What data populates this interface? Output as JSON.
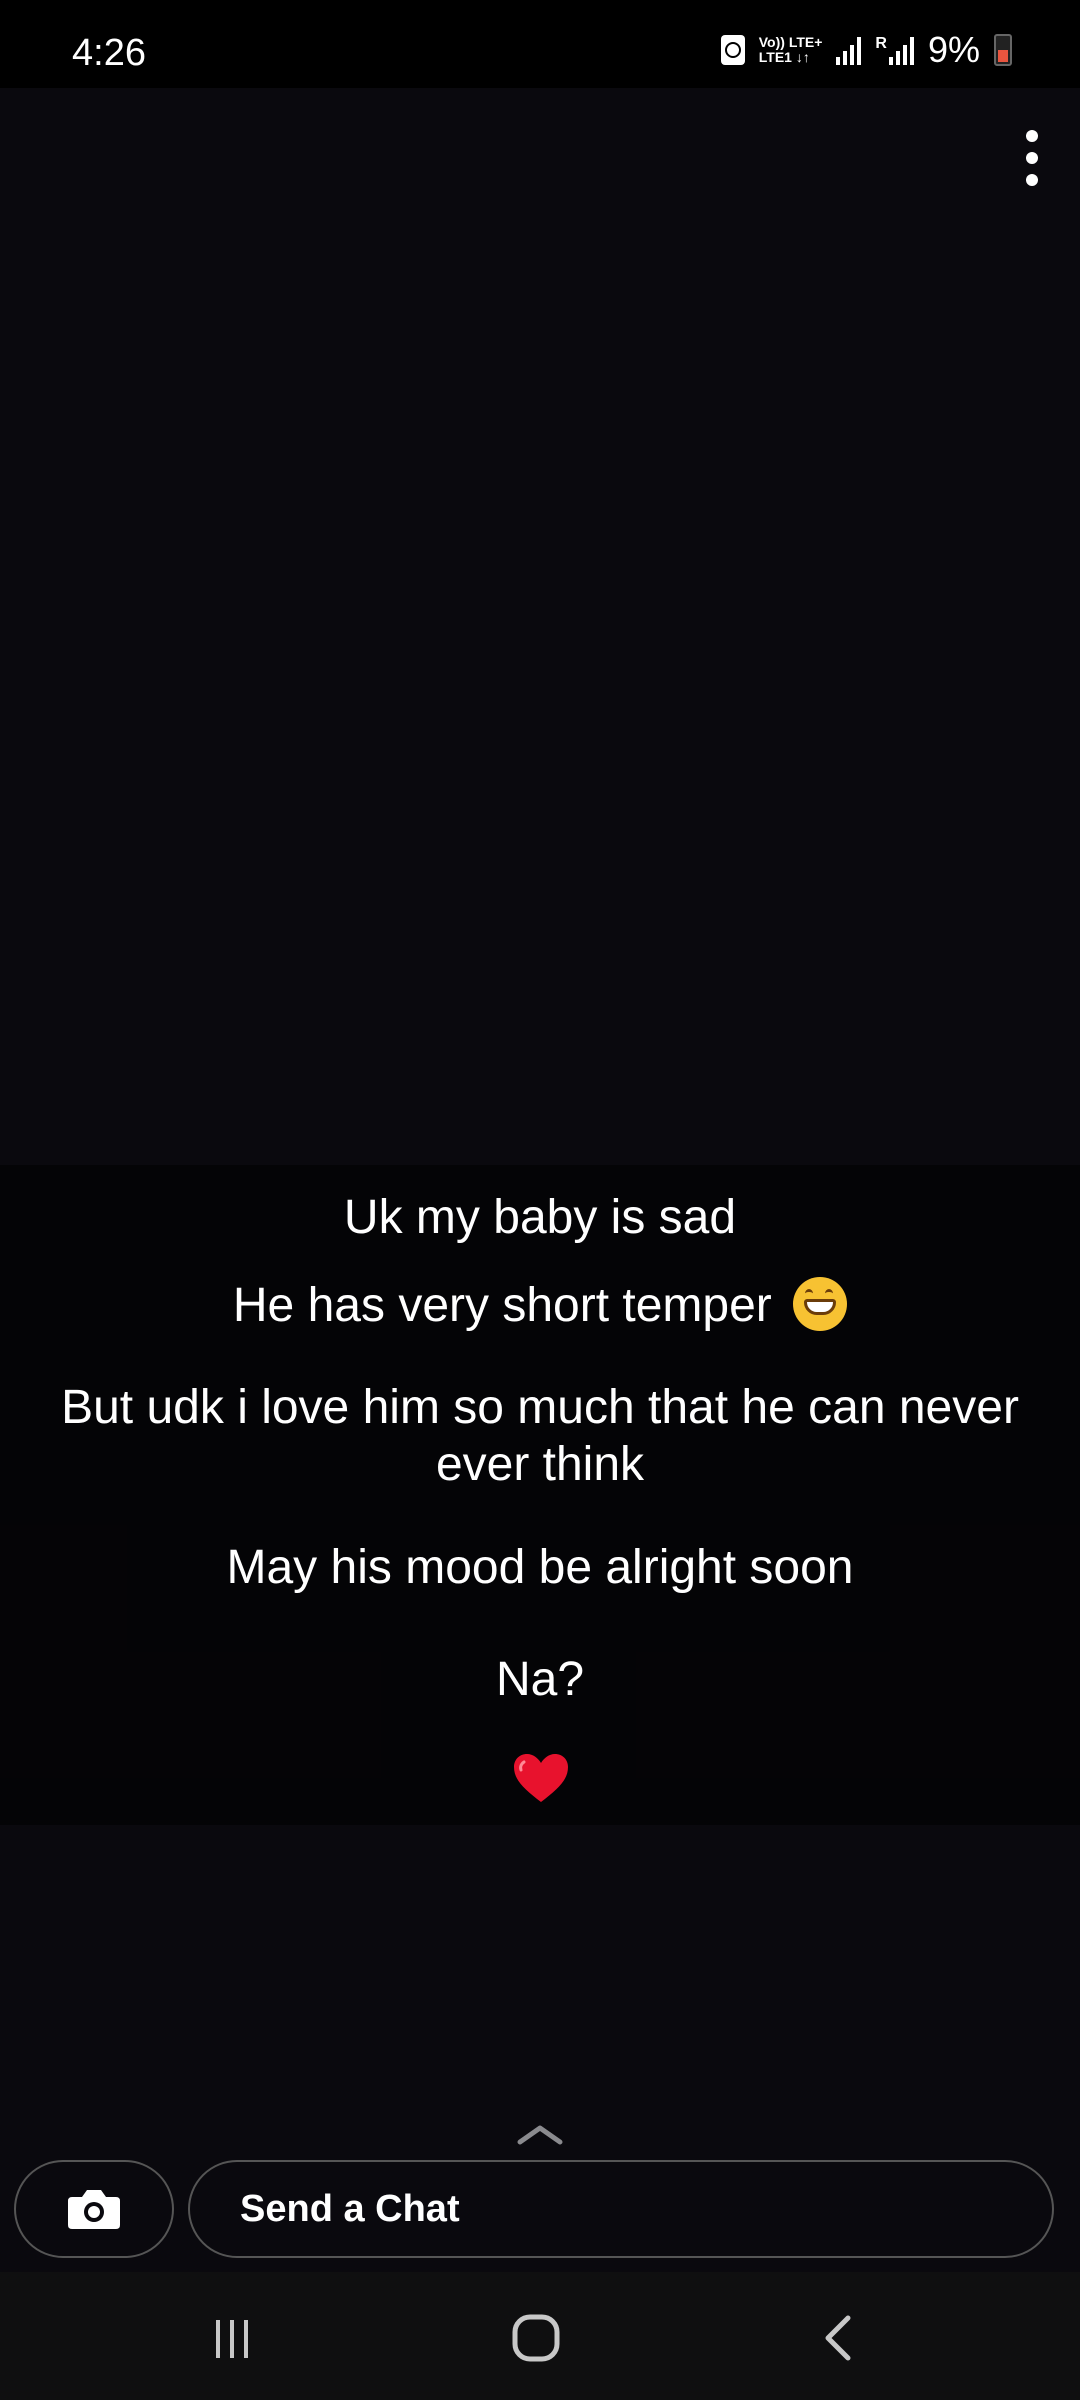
{
  "status_bar": {
    "time": "4:26",
    "tech_top": "Vo)) LTE+",
    "tech_bottom": "LTE1 ↓↑",
    "roaming": "R",
    "battery": "9%"
  },
  "caption": {
    "line1": "Uk my baby is sad",
    "line2": "He has very short temper",
    "line3a": "But udk i love him so much that he can never",
    "line3b": "ever think",
    "line4": "May his mood be alright soon",
    "line5": "Na?"
  },
  "chat": {
    "send_label": "Send a Chat"
  },
  "colors": {
    "background": "#0a090e",
    "heart": "#e8122d",
    "battery_low": "#e8553f"
  },
  "icons": {
    "menu": "more-vertical-icon",
    "camera": "camera-icon",
    "heart": "red-heart-emoji",
    "grin": "grinning-face-emoji",
    "swipe": "chevron-up-icon",
    "nav_recent": "recent-apps-icon",
    "nav_home": "home-icon",
    "nav_back": "back-icon"
  }
}
